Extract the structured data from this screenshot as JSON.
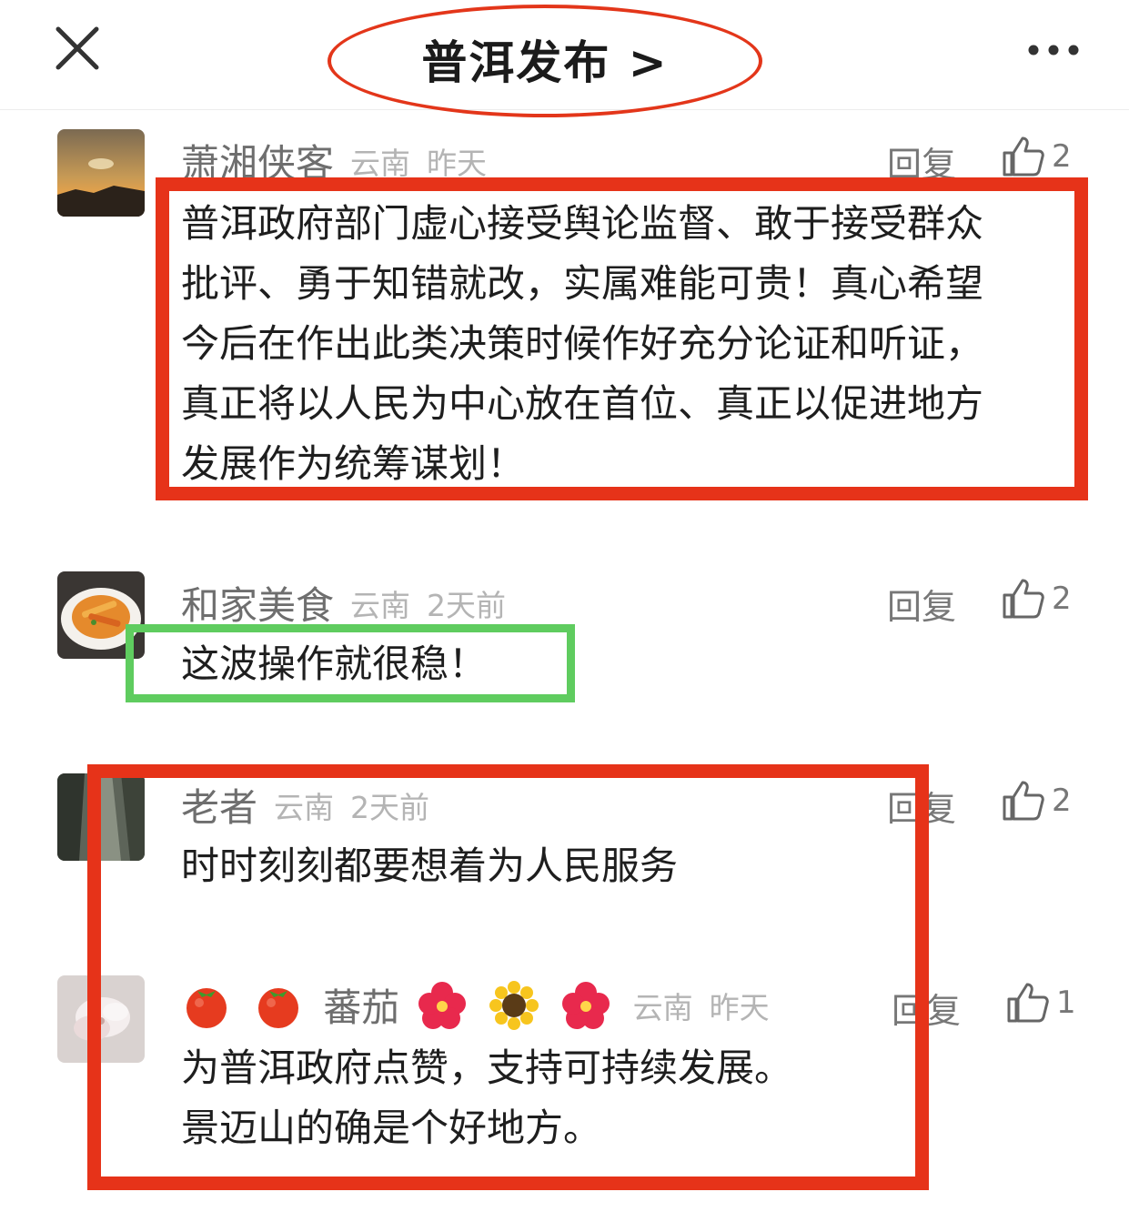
{
  "header": {
    "title": "普洱发布 >",
    "close_icon": "close-icon",
    "more_icon": "more-horizontal-icon",
    "annotation_oval_color": "#e3361a"
  },
  "comments": [
    {
      "username": "萧湘侠客",
      "location": "云南",
      "time": "昨天",
      "reply_label": "回复",
      "likes": "2",
      "text": "普洱政府部门虚心接受舆论监督、敢于接受群众\n批评、勇于知错就改，实属难能可贵！真心希望\n今后在作出此类决策时候作好充分论证和听证，\n真正将以人民为中心放在首位、真正以促进地方\n发展作为统筹谋划！"
    },
    {
      "username": "和家美食",
      "location": "云南",
      "time": "2天前",
      "reply_label": "回复",
      "likes": "2",
      "text": "这波操作就很稳！"
    },
    {
      "username": "老者",
      "location": "云南",
      "time": "2天前",
      "reply_label": "回复",
      "likes": "2",
      "text": "时时刻刻都要想着为人民服务"
    },
    {
      "username": "蕃茄",
      "username_emojis_before": [
        "tomato-icon",
        "tomato-icon"
      ],
      "username_emojis_after": [
        "hibiscus-icon",
        "sunflower-icon",
        "hibiscus-icon"
      ],
      "location": "云南",
      "time": "昨天",
      "reply_label": "回复",
      "likes": "1",
      "text": "为普洱政府点赞，支持可持续发展。\n景迈山的确是个好地方。"
    }
  ],
  "annotations": {
    "red_color": "#e63319",
    "green_color": "#5fcc5f"
  }
}
